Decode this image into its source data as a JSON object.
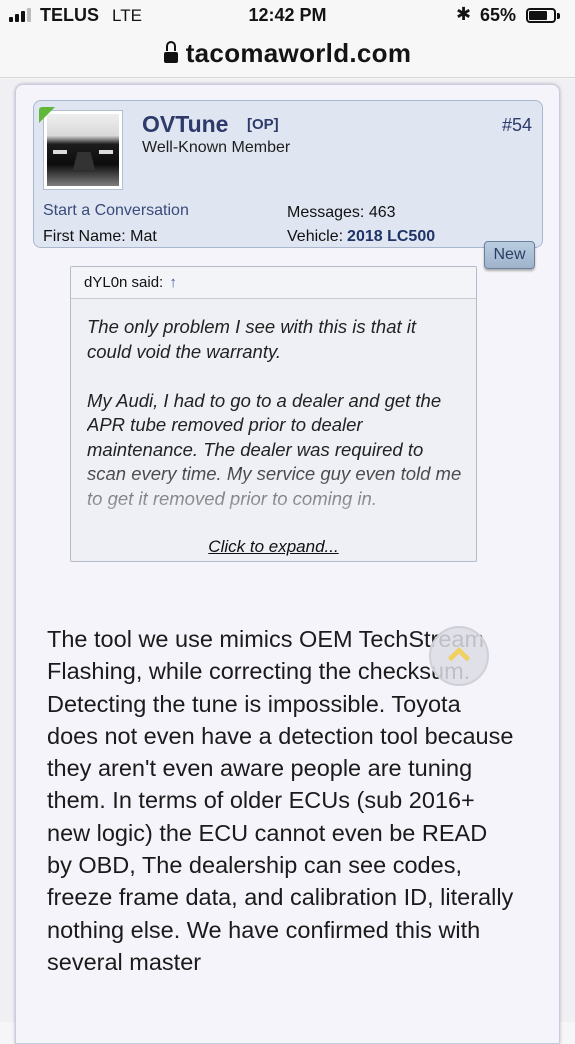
{
  "status_bar": {
    "carrier": "TELUS",
    "network": "LTE",
    "time": "12:42 PM",
    "battery_percent": "65%",
    "bluetooth_glyph": "✱"
  },
  "browser": {
    "url": "tacomaworld.com"
  },
  "post": {
    "author": "OVTune",
    "op_tag": "[OP]",
    "post_number": "#54",
    "user_title": "Well-Known Member",
    "start_conversation": "Start a Conversation",
    "first_name_label": "First Name:",
    "first_name_value": "Mat",
    "messages_label": "Messages:",
    "messages_value": "463",
    "vehicle_label": "Vehicle:",
    "vehicle_value": "2018 LC500",
    "new_badge": "New",
    "quote": {
      "author_said": "dYL0n said:",
      "up_arrow": "↑",
      "paragraph1": "The only problem I see with this is that it could void the warranty.",
      "paragraph2": "My Audi, I had to go to a dealer and get the APR tube removed prior to dealer maintenance. The dealer was required to scan every time. My service guy even told me to get it removed prior to coming in.",
      "expand_label": "Click to expand..."
    },
    "body_text": "The tool we use mimics OEM TechStream Flashing, while correcting the checksum. Detecting the tune is impossible. Toyota does not even have a detection tool because they aren't even aware people are tuning them. In terms of older ECUs (sub 2016+ new logic) the ECU cannot even be READ by OBD, The dealership can see codes, freeze frame data, and calibration ID, literally nothing else. We have confirmed this with several master"
  },
  "colors": {
    "username": "#2d3a6a",
    "user_card_bg": "#dfe6f2",
    "online_indicator": "#5fb83a",
    "scroll_chevron": "#f0d060"
  }
}
